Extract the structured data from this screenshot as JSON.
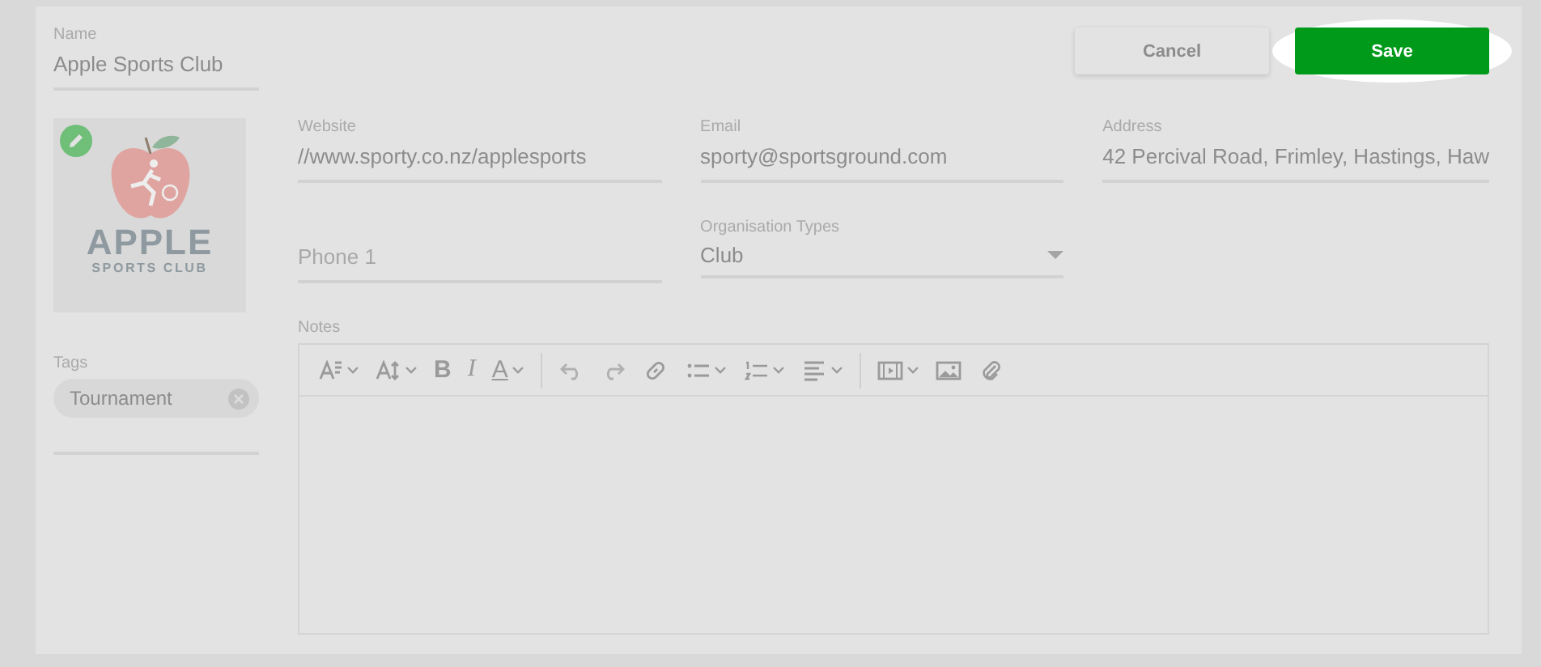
{
  "name_field": {
    "label": "Name",
    "value": "Apple Sports Club"
  },
  "logo": {
    "title": "APPLE",
    "subtitle": "SPORTS CLUB"
  },
  "buttons": [
    {
      "label": "Cancel",
      "kind": "secondary"
    },
    {
      "label": "Save",
      "kind": "primary",
      "highlighted": true
    }
  ],
  "fields": [
    {
      "label": "Website",
      "value": "//www.sporty.co.nz/applesports",
      "kind": "text"
    },
    {
      "label": "Email",
      "value": "sporty@sportsground.com",
      "kind": "text"
    },
    {
      "label": "Address",
      "value": "42 Percival Road, Frimley, Hastings, Haw",
      "kind": "text"
    },
    {
      "placeholder": "Phone 1",
      "kind": "text"
    },
    {
      "label": "Organisation Types",
      "value": "Club",
      "kind": "select"
    }
  ],
  "tags": {
    "label": "Tags",
    "items": [
      {
        "label": "Tournament"
      }
    ]
  },
  "notes": {
    "label": "Notes",
    "toolbar": [
      {
        "kind": "font-style",
        "dropdown": true
      },
      {
        "kind": "font-size",
        "dropdown": true
      },
      {
        "kind": "bold",
        "glyph": "B"
      },
      {
        "kind": "italic",
        "glyph": "I"
      },
      {
        "kind": "color",
        "glyph": "A",
        "dropdown": true
      },
      {
        "kind": "separator"
      },
      {
        "kind": "undo"
      },
      {
        "kind": "redo"
      },
      {
        "kind": "link"
      },
      {
        "kind": "bullets",
        "dropdown": true
      },
      {
        "kind": "numbers",
        "dropdown": true
      },
      {
        "kind": "align",
        "dropdown": true
      },
      {
        "kind": "separator"
      },
      {
        "kind": "video",
        "dropdown": true
      },
      {
        "kind": "image"
      },
      {
        "kind": "attach"
      }
    ]
  }
}
